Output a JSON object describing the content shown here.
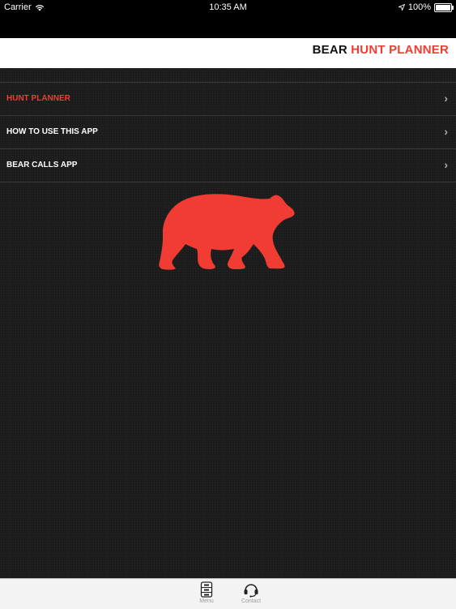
{
  "status_bar": {
    "carrier": "Carrier",
    "time": "10:35 AM",
    "battery": "100%",
    "icons": [
      "wifi-icon",
      "location-arrow-icon",
      "battery-icon"
    ]
  },
  "header": {
    "title_part1": "BEAR",
    "title_part2": "HUNT PLANNER",
    "accent_color": "#f03c32"
  },
  "menu": {
    "items": [
      {
        "label": "HUNT PLANNER",
        "active": true
      },
      {
        "label": "HOW TO USE THIS APP",
        "active": false
      },
      {
        "label": "BEAR CALLS APP",
        "active": false
      }
    ]
  },
  "hero": {
    "icon": "bear-silhouette-icon",
    "color": "#f03c32"
  },
  "tab_bar": {
    "tabs": [
      {
        "label": "Menu",
        "icon": "menu-drawer-icon",
        "selected": true
      },
      {
        "label": "Contact",
        "icon": "headset-icon",
        "selected": false
      }
    ]
  }
}
